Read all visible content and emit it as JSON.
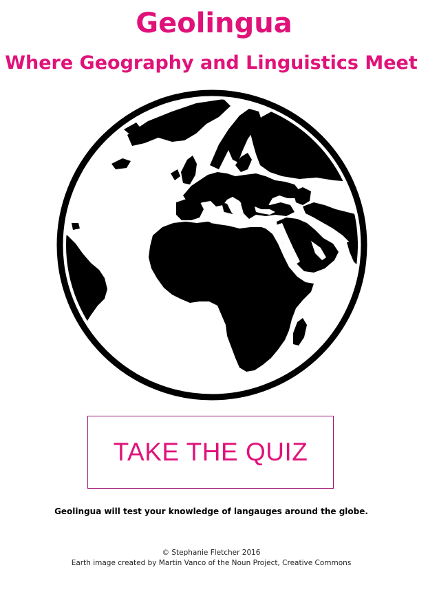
{
  "header": {
    "title": "Geolingua",
    "subtitle": "Where Geography and Linguistics Meet"
  },
  "hero": {
    "image_icon": "globe-icon"
  },
  "cta": {
    "label": "TAKE THE QUIZ"
  },
  "description": {
    "text": "Geolingua will test your knowledge of langauges around the globe."
  },
  "footer": {
    "copyright": "© Stephanie Fletcher 2016",
    "credit": "Earth image created by Martin Vanco of the Noun Project, Creative Commons"
  },
  "colors": {
    "accent": "#e0127a",
    "button_border": "#a0177a",
    "text": "#000000",
    "background": "#ffffff"
  }
}
